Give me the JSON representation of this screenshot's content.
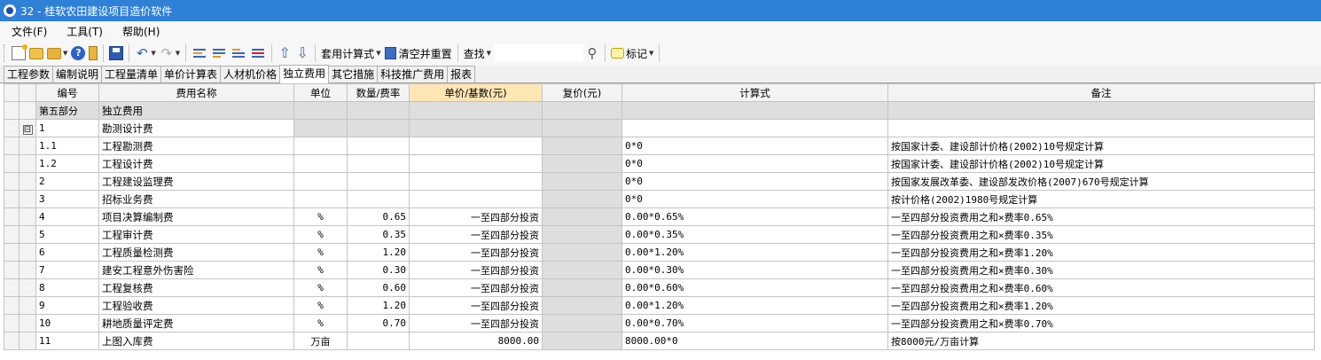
{
  "window": {
    "title": "32 - 桂软农田建设项目造价软件"
  },
  "menu": [
    "文件(F)",
    "工具(T)",
    "帮助(H)"
  ],
  "toolbar": {
    "apply_formula_label": "套用计算式",
    "clear_reset_label": "清空并重置",
    "find_label": "查找",
    "search_value": "",
    "mark_label": "标记"
  },
  "tabs": [
    {
      "label": "工程参数",
      "active": false
    },
    {
      "label": "编制说明",
      "active": false
    },
    {
      "label": "工程量清单",
      "active": false
    },
    {
      "label": "单价计算表",
      "active": false
    },
    {
      "label": "人材机价格",
      "active": false
    },
    {
      "label": "独立费用",
      "active": true
    },
    {
      "label": "其它措施",
      "active": false
    },
    {
      "label": "科技推广费用",
      "active": false
    },
    {
      "label": "报表",
      "active": false
    }
  ],
  "table": {
    "headers": [
      "编号",
      "费用名称",
      "单位",
      "数量/费率",
      "单价/基数(元)",
      "复价(元)",
      "计算式",
      "备注"
    ],
    "rows": [
      {
        "code": "第五部分",
        "name": "独立费用",
        "unit": "",
        "qty": "",
        "price": "",
        "total": "",
        "formula": "",
        "note": "",
        "type": "part"
      },
      {
        "code": "1",
        "name": "勘测设计费",
        "unit": "",
        "qty": "",
        "price": "",
        "total": "",
        "formula": "",
        "note": "",
        "type": "group",
        "toggle": "⊟"
      },
      {
        "code": "1.1",
        "name": "工程勘测费",
        "unit": "",
        "qty": "",
        "price": "",
        "total": "",
        "formula": "0*0",
        "note": "按国家计委、建设部计价格(2002)10号规定计算"
      },
      {
        "code": "1.2",
        "name": "工程设计费",
        "unit": "",
        "qty": "",
        "price": "",
        "total": "",
        "formula": "0*0",
        "note": "按国家计委、建设部计价格(2002)10号规定计算"
      },
      {
        "code": "2",
        "name": "工程建设监理费",
        "unit": "",
        "qty": "",
        "price": "",
        "total": "",
        "formula": "0*0",
        "note": "按国家发展改革委、建设部发改价格(2007)670号规定计算"
      },
      {
        "code": "3",
        "name": "招标业务费",
        "unit": "",
        "qty": "",
        "price": "",
        "total": "",
        "formula": "0*0",
        "note": "按计价格(2002)1980号规定计算"
      },
      {
        "code": "4",
        "name": "项目决算编制费",
        "unit": "%",
        "qty": "0.65",
        "price": "一至四部分投资",
        "total": "",
        "formula": "0.00*0.65%",
        "note": "一至四部分投资费用之和×费率0.65%"
      },
      {
        "code": "5",
        "name": "工程审计费",
        "unit": "%",
        "qty": "0.35",
        "price": "一至四部分投资",
        "total": "",
        "formula": "0.00*0.35%",
        "note": "一至四部分投资费用之和×费率0.35%"
      },
      {
        "code": "6",
        "name": "工程质量检测费",
        "unit": "%",
        "qty": "1.20",
        "price": "一至四部分投资",
        "total": "",
        "formula": "0.00*1.20%",
        "note": "一至四部分投资费用之和×费率1.20%"
      },
      {
        "code": "7",
        "name": "建安工程意外伤害险",
        "unit": "%",
        "qty": "0.30",
        "price": "一至四部分投资",
        "total": "",
        "formula": "0.00*0.30%",
        "note": "一至四部分投资费用之和×费率0.30%"
      },
      {
        "code": "8",
        "name": "工程复核费",
        "unit": "%",
        "qty": "0.60",
        "price": "一至四部分投资",
        "total": "",
        "formula": "0.00*0.60%",
        "note": "一至四部分投资费用之和×费率0.60%"
      },
      {
        "code": "9",
        "name": "工程验收费",
        "unit": "%",
        "qty": "1.20",
        "price": "一至四部分投资",
        "total": "",
        "formula": "0.00*1.20%",
        "note": "一至四部分投资费用之和×费率1.20%"
      },
      {
        "code": "10",
        "name": "耕地质量评定费",
        "unit": "%",
        "qty": "0.70",
        "price": "一至四部分投资",
        "total": "",
        "formula": "0.00*0.70%",
        "note": "一至四部分投资费用之和×费率0.70%"
      },
      {
        "code": "11",
        "name": "上图入库费",
        "unit": "万亩",
        "qty": "",
        "price": "8000.00",
        "total": "",
        "formula": "8000.00*0",
        "note": "按8000元/万亩计算"
      }
    ]
  },
  "colors": {
    "titlebar": "#2f81d8",
    "header_highlight": "#ffe6b5",
    "gray_cell": "#dedede"
  }
}
